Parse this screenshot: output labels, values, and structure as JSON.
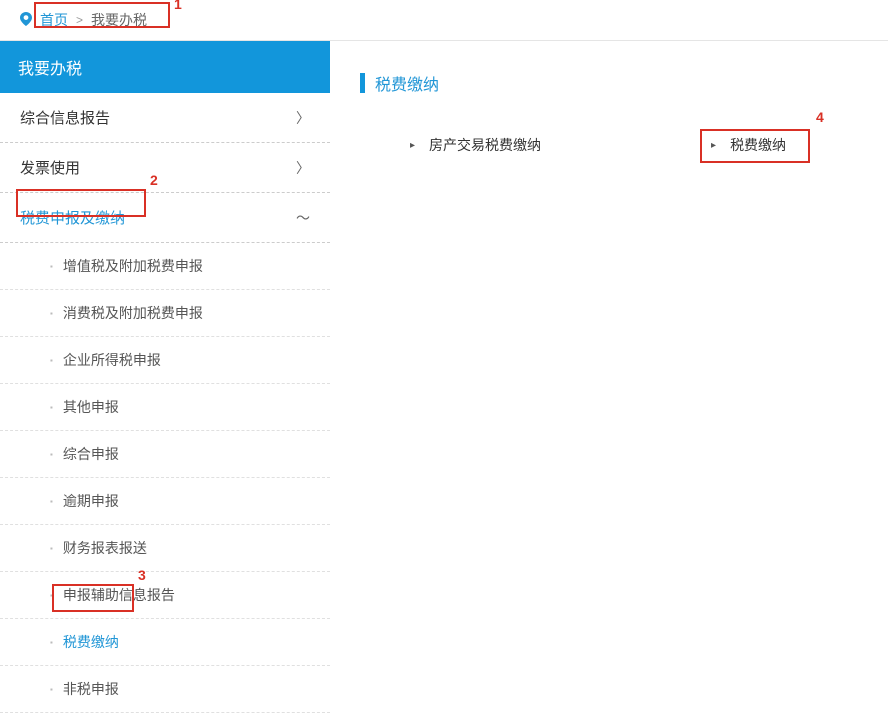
{
  "breadcrumb": {
    "home": "首页",
    "current": "我要办税"
  },
  "sidebar": {
    "header": "我要办税",
    "items": [
      {
        "label": "综合信息报告",
        "expanded": false
      },
      {
        "label": "发票使用",
        "expanded": false
      },
      {
        "label": "税费申报及缴纳",
        "expanded": true,
        "subitems": [
          {
            "label": "增值税及附加税费申报"
          },
          {
            "label": "消费税及附加税费申报"
          },
          {
            "label": "企业所得税申报"
          },
          {
            "label": "其他申报"
          },
          {
            "label": "综合申报"
          },
          {
            "label": "逾期申报"
          },
          {
            "label": "财务报表报送"
          },
          {
            "label": "申报辅助信息报告"
          },
          {
            "label": "税费缴纳",
            "active": true
          },
          {
            "label": "非税申报"
          }
        ]
      }
    ]
  },
  "main": {
    "section_title": "税费缴纳",
    "links": [
      {
        "label": "房产交易税费缴纳"
      },
      {
        "label": "税费缴纳"
      }
    ]
  },
  "annotations": {
    "a1": "1",
    "a2": "2",
    "a3": "3",
    "a4": "4"
  }
}
